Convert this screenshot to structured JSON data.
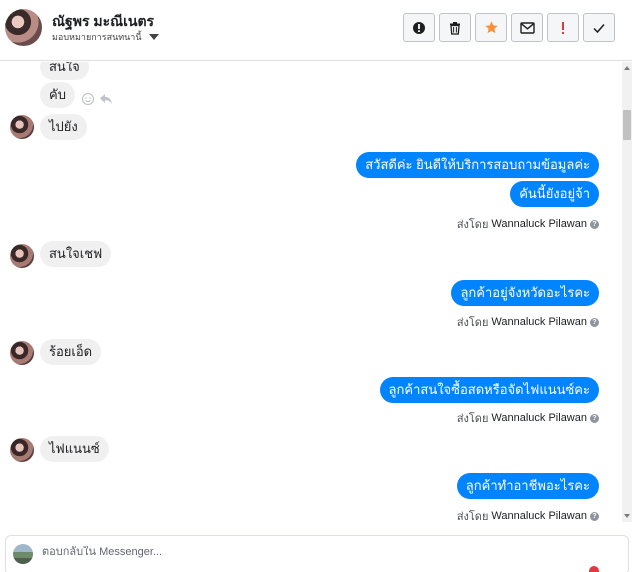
{
  "header": {
    "contact_name": "ณัฐพร มะณีเนตร",
    "assignee_label": "มอบหมายการสนทนานี้",
    "toolbar": [
      {
        "name": "alert-icon",
        "color": "#1c1e21"
      },
      {
        "name": "trash-icon",
        "color": "#1c1e21"
      },
      {
        "name": "star-icon",
        "color": "#f7923b"
      },
      {
        "name": "envelope-icon",
        "color": "#1c1e21"
      },
      {
        "name": "exclamation-icon",
        "color": "#e0393e"
      },
      {
        "name": "checkmark-icon",
        "color": "#1c1e21"
      }
    ]
  },
  "messages": {
    "in_1": "สนใจ",
    "in_2": "คับ",
    "in_3": "ไปยัง",
    "out_1": "สวัสดีค่ะ  ยินดีให้บริการสอบถามข้อมูลค่ะ",
    "out_2": "คันนี้ยังอยู่จ้า",
    "in_4": "สนใจเชฟ",
    "out_3": "ลูกค้าอยู่จังหวัดอะไรคะ",
    "in_5": "ร้อยเอ็ด",
    "out_4": "ลูกค้าสนใจซื้อสดหรือจัดไฟแนนซ์คะ",
    "in_6": "ไฟแนนซ์",
    "out_5": "ลูกค้าทำอาชีพอะไรคะ"
  },
  "sent_by": {
    "prefix": "ส่งโดย",
    "name": "Wannaluck Pilawan",
    "help_glyph": "?"
  },
  "reply": {
    "placeholder": "ตอบกลับใน Messenger..."
  },
  "colors": {
    "outgoing_bubble": "#0084ff",
    "incoming_bubble": "#f1f0f0",
    "star": "#f7923b",
    "alert_red": "#e0393e"
  }
}
